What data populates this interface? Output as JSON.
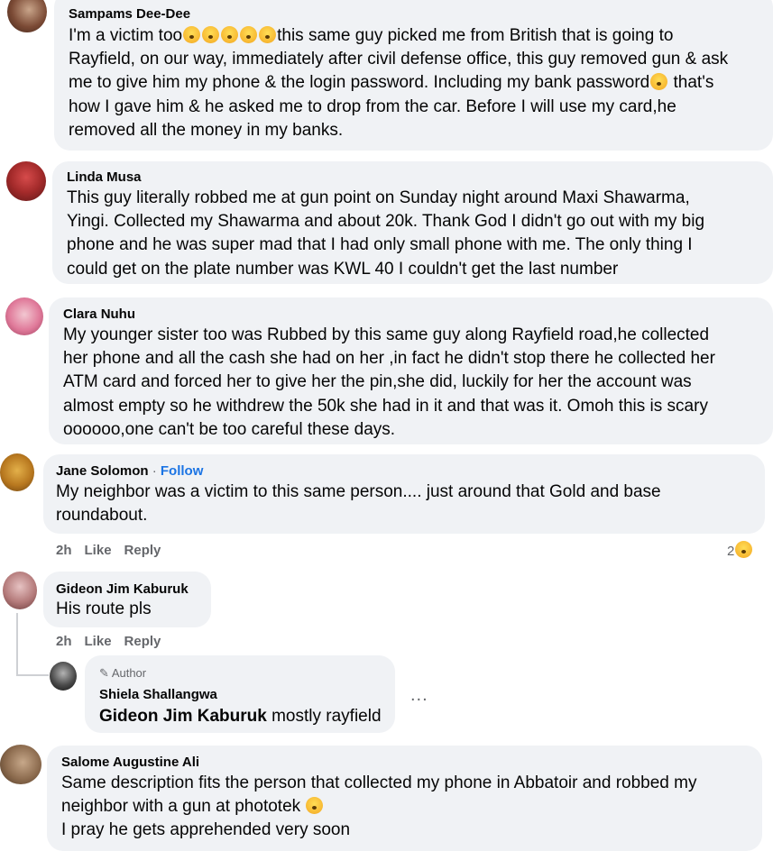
{
  "comments": [
    {
      "name": "Sampams Dee-Dee",
      "lines": [
        "I'm a victim too",
        "this same guy picked me from British that is going to",
        "Rayfield, on our way, immediately after civil defense office, this guy removed gun & ask",
        "me to give him my phone & the login password. Including my bank password",
        "that's",
        "how I gave him & he asked me to drop from the car. Before I will use my card,he",
        "removed all the money in my banks."
      ]
    },
    {
      "name": "Linda Musa",
      "lines": [
        "This guy literally robbed me at gun point on Sunday night around Maxi Shawarma,",
        "Yingi. Collected my Shawarma and about 20k. Thank God I didn't go out with my big",
        "phone and he was super mad that I had only small phone with me. The only thing I",
        "could get on the plate number was KWL 40 I couldn't get the last number"
      ]
    },
    {
      "name": "Clara Nuhu",
      "lines": [
        "My younger sister too was Rubbed by this same guy along Rayfield road,he collected",
        "her phone and all the cash she had on her ,in fact he didn't stop there he collected her",
        "ATM card and forced her to give her the pin,she did, luckily for her the account was",
        "almost empty so he withdrew the 50k she had in it and that was it. Omoh this is scary",
        "oooooo,one can't be too careful these days."
      ]
    },
    {
      "name": "Jane Solomon",
      "follow": "Follow",
      "lines": [
        "My neighbor was a victim to this same person.... just around that Gold and base",
        "roundabout."
      ],
      "time": "2h",
      "like": "Like",
      "reply": "Reply",
      "reaction_count": "2"
    },
    {
      "name": "Gideon Jim Kaburuk",
      "lines": [
        "His route pls"
      ],
      "time": "2h",
      "like": "Like",
      "reply": "Reply"
    },
    {
      "author_label": "Author",
      "name": "Shiela Shallangwa",
      "mention": "Gideon Jim Kaburuk",
      "text": "mostly rayfield",
      "more": "..."
    },
    {
      "name": "Salome Augustine Ali",
      "lines": [
        "Same description fits the person that collected my phone in Abbatoir and robbed my",
        "neighbor with a gun at phototek",
        "I pray he gets apprehended very soon"
      ]
    }
  ],
  "colors": {
    "bubble": "#f0f2f5",
    "link": "#1b74e4",
    "meta": "#65676b"
  }
}
